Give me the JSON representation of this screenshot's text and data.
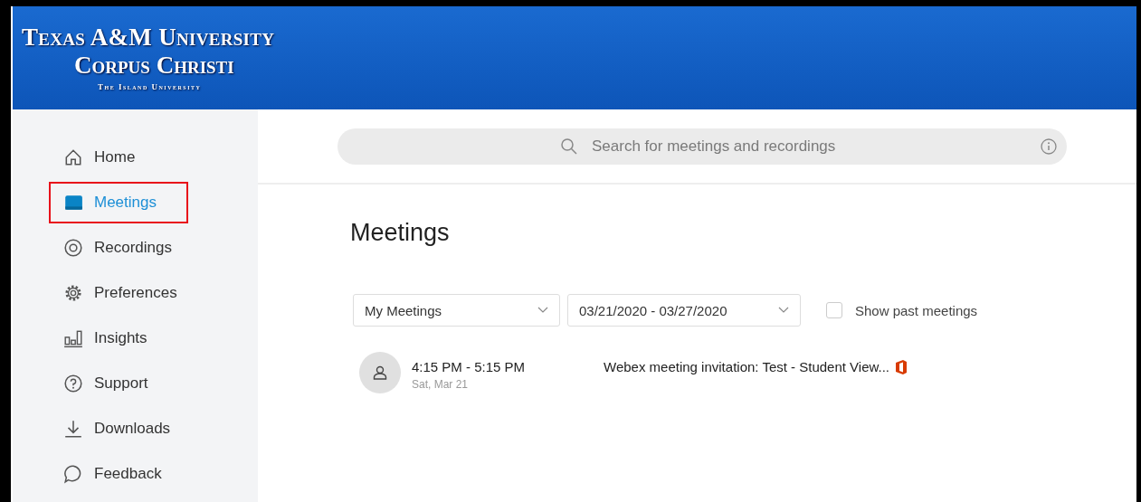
{
  "header": {
    "logo_line_1": "Texas A&M University",
    "logo_line_2": "Corpus Christi",
    "logo_tagline": "The Island University"
  },
  "sidebar": {
    "items": [
      {
        "label": "Home",
        "selected": false,
        "annotated": false
      },
      {
        "label": "Meetings",
        "selected": true,
        "annotated": true
      },
      {
        "label": "Recordings",
        "selected": false,
        "annotated": false
      },
      {
        "label": "Preferences",
        "selected": false,
        "annotated": false
      },
      {
        "label": "Insights",
        "selected": false,
        "annotated": false
      },
      {
        "label": "Support",
        "selected": false,
        "annotated": false
      },
      {
        "label": "Downloads",
        "selected": false,
        "annotated": false
      },
      {
        "label": "Feedback",
        "selected": false,
        "annotated": false
      }
    ]
  },
  "search": {
    "placeholder": "Search for meetings and recordings"
  },
  "page_title": "Meetings",
  "filters": {
    "meeting_type": "My Meetings",
    "date_range": "03/21/2020 - 03/27/2020",
    "show_past": {
      "label": "Show past meetings",
      "checked": false
    }
  },
  "meetings": [
    {
      "time": "4:15 PM - 5:15 PM",
      "date": "Sat, Mar 21",
      "title": "Webex meeting invitation: Test - Student View..."
    }
  ]
}
